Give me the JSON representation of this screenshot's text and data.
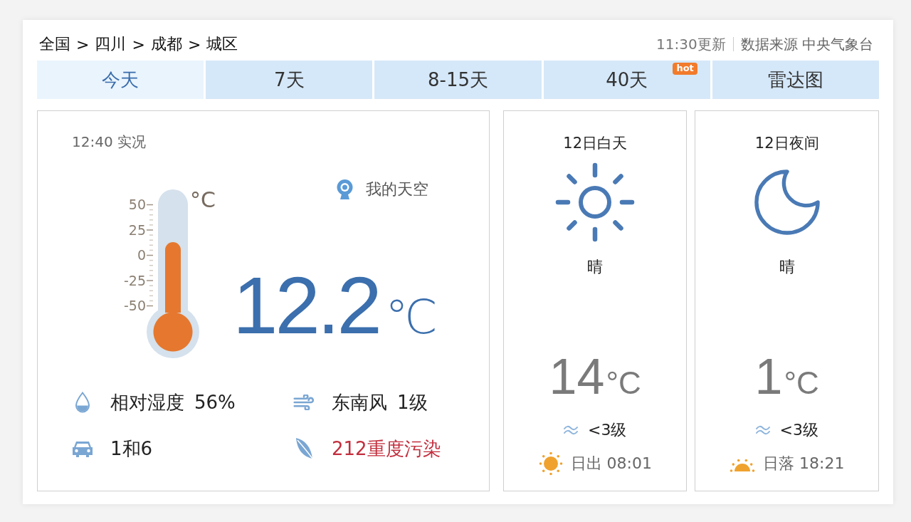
{
  "breadcrumb": {
    "items": [
      "全国",
      "四川",
      "成都",
      "城区"
    ],
    "separator": ">"
  },
  "meta": {
    "updated": "11:30更新",
    "source": "数据来源 中央气象台"
  },
  "tabs": [
    {
      "label": "今天",
      "selected": true
    },
    {
      "label": "7天",
      "selected": false
    },
    {
      "label": "8-15天",
      "selected": false
    },
    {
      "label": "40天",
      "selected": false,
      "badge": "hot"
    },
    {
      "label": "雷达图",
      "selected": false
    }
  ],
  "current": {
    "observed": "12:40 实况",
    "my_sky": "我的天空",
    "thermometer": {
      "ticks": [
        "50",
        "25",
        "0",
        "-25",
        "-50"
      ],
      "unit": "°C",
      "level": 0.6
    },
    "temperature": "12.2",
    "unit": "℃",
    "details": [
      {
        "kind": "humidity",
        "label": "相对湿度",
        "value": "56%",
        "alert": false
      },
      {
        "kind": "wind",
        "label": "东南风",
        "value": "1级",
        "alert": false
      },
      {
        "kind": "traffic",
        "label": "1和6",
        "alert": false
      },
      {
        "kind": "air",
        "label": "212重度污染",
        "alert": true
      }
    ]
  },
  "forecast": [
    {
      "kind": "day",
      "title": "12日白天",
      "weather": "晴",
      "temperature": "14",
      "unit": "°C",
      "wind": "<3级",
      "sun_event": "日出 08:01"
    },
    {
      "kind": "night",
      "title": "12日夜间",
      "weather": "晴",
      "temperature": "1",
      "unit": "°C",
      "wind": "<3级",
      "sun_event": "日落 18:21"
    }
  ]
}
